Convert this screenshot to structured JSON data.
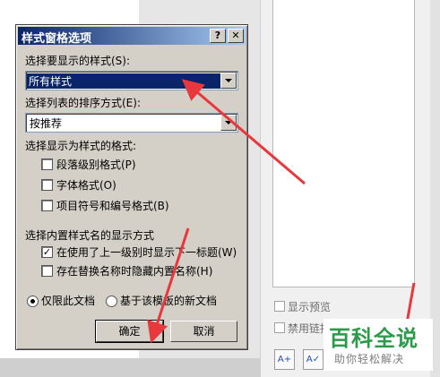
{
  "dialog": {
    "title": "样式窗格选项",
    "help_glyph": "?",
    "close_glyph": "✕",
    "select_styles_label": "选择要显示的样式(S):",
    "select_styles_value": "所有样式",
    "sort_label": "选择列表的排序方式(E):",
    "sort_value": "按推荐",
    "format_section_label": "选择显示为样式的格式:",
    "format_options": [
      {
        "label": "段落级别格式(P)",
        "checked": false
      },
      {
        "label": "字体格式(O)",
        "checked": false
      },
      {
        "label": "项目符号和编号格式(B)",
        "checked": false
      }
    ],
    "builtin_section_label": "选择内置样式名的显示方式",
    "builtin_options": [
      {
        "label": "在使用了上一级别时显示下一标题(W)",
        "checked": true
      },
      {
        "label": "存在替换名称时隐藏内置名称(H)",
        "checked": false
      }
    ],
    "scope_options": [
      {
        "label": "仅限此文档",
        "selected": true
      },
      {
        "label": "基于该模板的新文档",
        "selected": false
      }
    ],
    "ok_label": "确定",
    "cancel_label": "取消",
    "check_glyph": "✓"
  },
  "styles_pane": {
    "preview_label": "显示预览",
    "disable_linked_label": "禁用链接样式",
    "new_style_icon": "new-style-icon",
    "style_inspector_icon": "style-inspector-icon"
  },
  "watermark": {
    "brand": "百科全说",
    "tagline": "助你轻松解决"
  },
  "colors": {
    "annotation_arrow": "#e8383d",
    "title_bar": "#0a246a",
    "watermark_green": "#2b9b49"
  }
}
